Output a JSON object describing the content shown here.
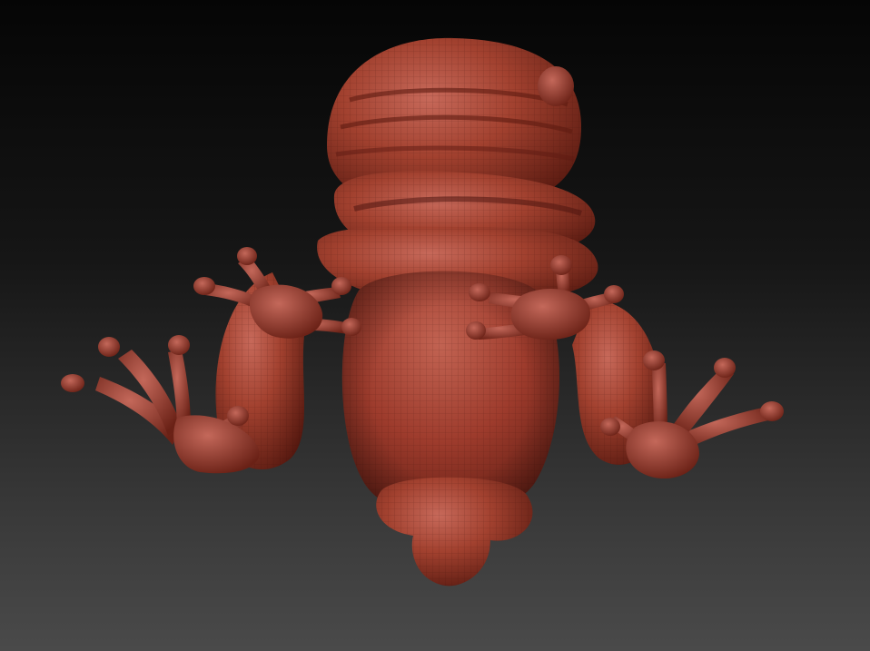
{
  "scene": {
    "subject": "frog-sculpt",
    "view": "underside",
    "colors": {
      "background_top": "#050505",
      "background_bottom": "#4a4a4a",
      "clay_light": "#c0604f",
      "clay_mid": "#9b3b2e",
      "clay_dark": "#4e1610"
    }
  }
}
